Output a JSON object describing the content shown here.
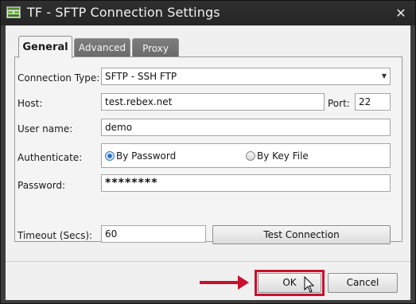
{
  "window": {
    "title": "TF - SFTP Connection Settings",
    "close_glyph": "✕"
  },
  "tabs": [
    {
      "label": "General",
      "active": true
    },
    {
      "label": "Advanced",
      "active": false
    },
    {
      "label": "Proxy",
      "active": false
    }
  ],
  "form": {
    "connection_type_label": "Connection Type:",
    "connection_type_value": "SFTP - SSH FTP",
    "host_label": "Host:",
    "host_value": "test.rebex.net",
    "port_label": "Port:",
    "port_value": "22",
    "username_label": "User name:",
    "username_value": "demo",
    "authenticate_label": "Authenticate:",
    "auth_options": [
      "By Password",
      "By Key File"
    ],
    "auth_selected": "By Password",
    "password_label": "Password:",
    "password_value": "********",
    "timeout_label": "Timeout (Secs):",
    "timeout_value": "60",
    "test_connection_label": "Test Connection"
  },
  "footer": {
    "ok_label": "OK",
    "cancel_label": "Cancel"
  },
  "colors": {
    "titlebar": "#2b2b2b",
    "highlight": "#c8102e"
  },
  "icons": [
    "app-icon",
    "close-icon",
    "dropdown-arrow-icon",
    "arrow-annotation",
    "mouse-cursor-icon"
  ]
}
